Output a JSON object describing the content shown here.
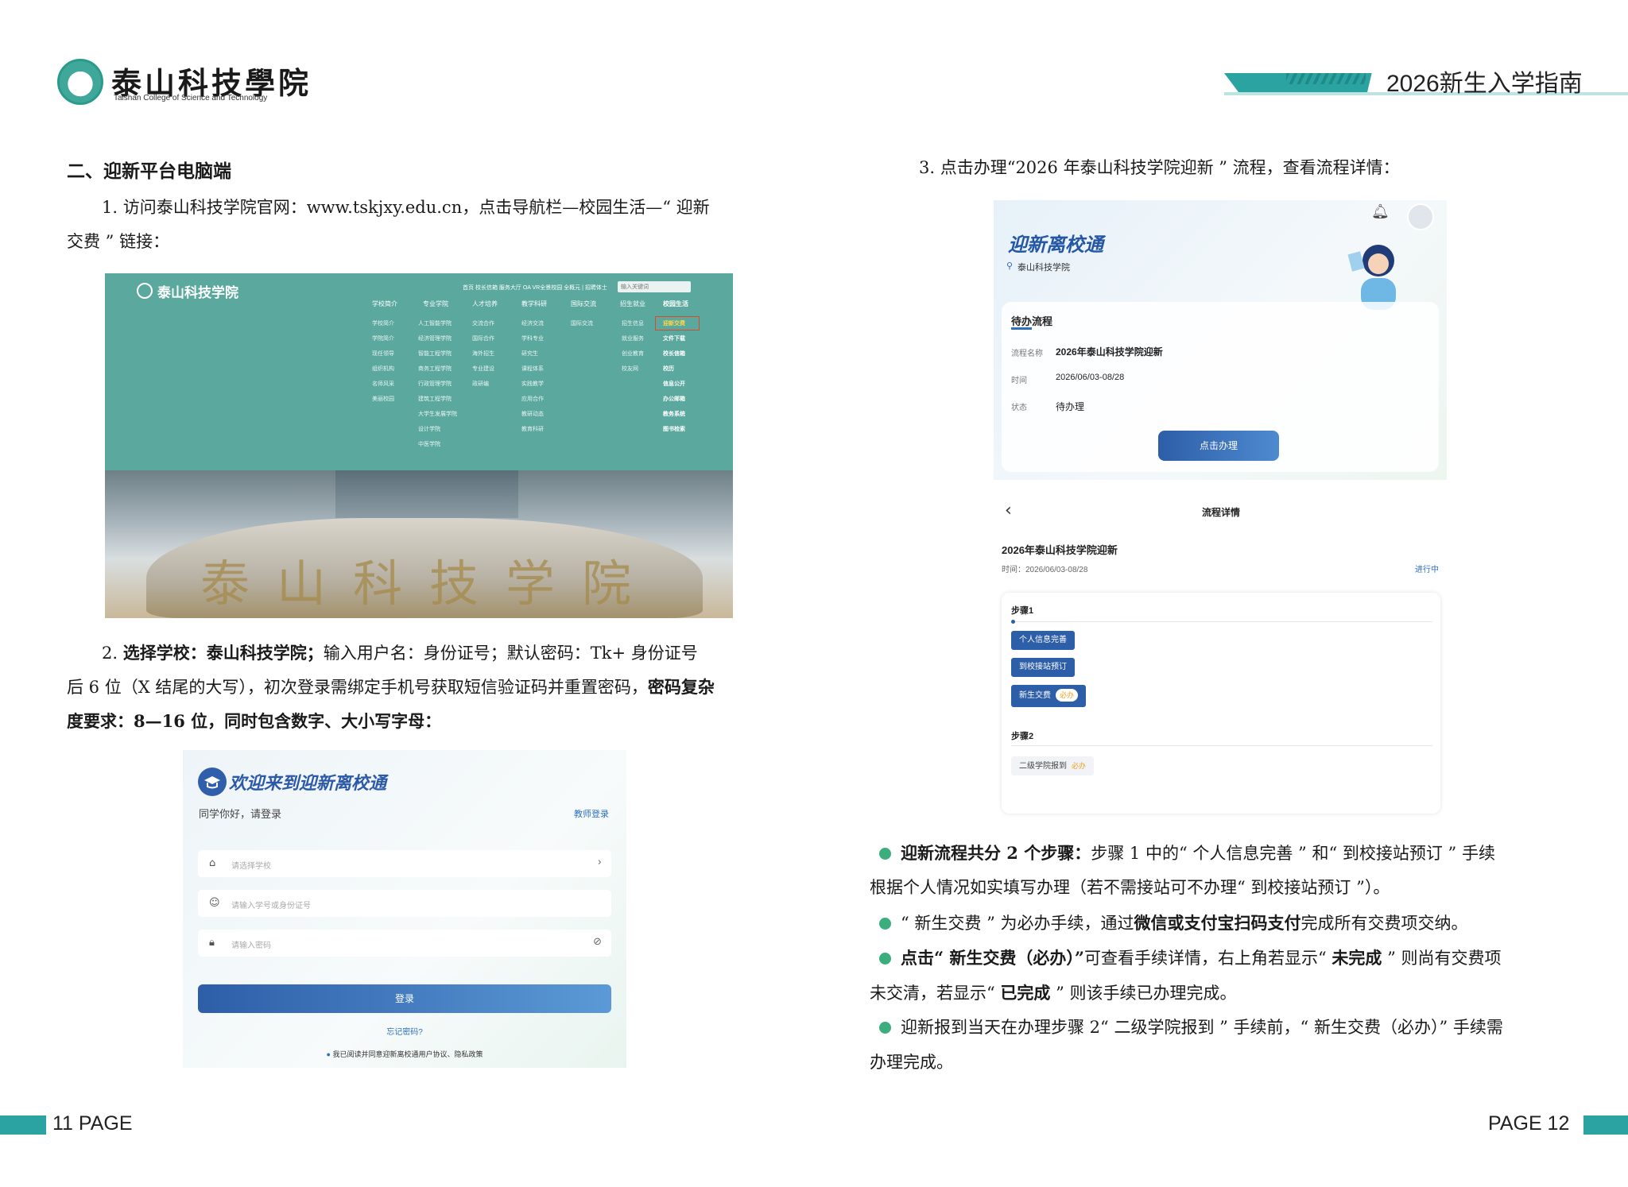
{
  "header": {
    "logo_cn": "泰山科技學院",
    "logo_en": "Taishan College of Science and Technology",
    "guide_title": "2026新生入学指南"
  },
  "left": {
    "section_title": "二、迎新平台电脑端",
    "step1_line1": "1. 访问泰山科技学院官网：www.tskjxy.edu.cn，点击导航栏—校园生活—“ 迎新",
    "step1_line2": "交费 ” 链接：",
    "step2_l1_a": "2. ",
    "step2_l1_b": "选择学校：泰山科技学院；",
    "step2_l1_c": "输入用户名：身份证号；默认密码：Tk+ 身份证号",
    "step2_l2_a": "后 6 位（X 结尾的大写），初次登录需绑定手机号获取短信验证码并重置密码，",
    "step2_l2_b": "密码复杂",
    "step2_l3_a": "度要求：",
    "step2_l3_b": "8—16 位，同时包含数字、大小写字母："
  },
  "website": {
    "logo": "泰山科技学院",
    "toplinks": "首页  校长信箱  服务大厅  OA  VR全景校园  全概元  |  招聘体士",
    "search_placeholder": "输入关键词",
    "nav": [
      "学校简介",
      "专业学院",
      "人才培养",
      "教学科研",
      "国际交流",
      "招生就业",
      "校园生活"
    ],
    "col1": [
      "学校简介",
      "学院简介",
      "现任领导",
      "组织机构",
      "名师风采",
      "美丽校园"
    ],
    "col2": [
      "人工智能学院",
      "经济管理学院",
      "智能工程学院",
      "商务工程学院",
      "行政管理学院",
      "建筑工程学院",
      "大学生发展学院",
      "设计学院",
      "中医学院"
    ],
    "col3": [
      "交流合作",
      "国际合作",
      "海外招生",
      "专业建设",
      "政研编"
    ],
    "col4": [
      "经济交流",
      "学科专业",
      "研究生",
      "课程体系",
      "实践教学",
      "应用合作",
      "教研动态",
      "教育科研"
    ],
    "col5": [
      "国际交流"
    ],
    "col6": [
      "招生信息",
      "就业服务",
      "创业教育",
      "校友网"
    ],
    "col7": [
      "迎新交费",
      "文件下载",
      "校长信箱",
      "校历",
      "信息公开",
      "办公邮箱",
      "教务系统",
      "图书检索"
    ],
    "stone_text": "泰山科技学院"
  },
  "login": {
    "title": "欢迎来到迎新离校通",
    "hello": "同学你好，请登录",
    "teacher_link": "教师登录",
    "school_placeholder": "请选择学校",
    "user_placeholder": "请输入学号或身份证号",
    "password_placeholder": "请输入密码",
    "login_button": "登录",
    "forgot": "忘记密码?",
    "agree": "我已阅读并同意迎新离校通用户协议、隐私政策"
  },
  "right": {
    "step3": "3. 点击办理“2026 年泰山科技学院迎新 ” 流程，查看流程详情："
  },
  "app": {
    "title": "迎新离校通",
    "school": "泰山科技学院",
    "pending_title": "待办流程",
    "k_name": "流程名称",
    "v_name": "2026年泰山科技学院迎新",
    "k_time": "时间",
    "v_time": "2026/06/03-08/28",
    "k_status": "状态",
    "v_status": "待办理",
    "button": "点击办理"
  },
  "detail": {
    "title": "流程详情",
    "name": "2026年泰山科技学院迎新",
    "time": "时间：2026/06/03-08/28",
    "status": "进行中",
    "step1": "步骤1",
    "tag1": "个人信息完善",
    "tag2": "到校接站预订",
    "tag3": "新生交费",
    "required": "必办",
    "step2": "步骤2",
    "tag4": "二级学院报到"
  },
  "notes": {
    "n1_a": "迎新流程共分 2 个步骤：",
    "n1_b": "步骤 1 中的“ 个人信息完善 ” 和“ 到校接站预订 ” 手续",
    "n1_c": "根据个人情况如实填写办理（若不需接站可不办理“ 到校接站预订 ”）。",
    "n2_a": "“ 新生交费 ” 为必办手续，通过",
    "n2_b": "微信或支付宝扫码支付",
    "n2_c": "完成所有交费项交纳。",
    "n3_a": "点击“ 新生交费（必办）”",
    "n3_b": "可查看手续详情，右上角若显示“ ",
    "n3_c": "未完成",
    "n3_d": " ” 则尚有交费项",
    "n3_e": "未交清，若显示“ ",
    "n3_f": "已完成",
    "n3_g": " ” 则该手续已办理完成。",
    "n4_a": "迎新报到当天在办理步骤 2“ 二级学院报到 ” 手续前，“ 新生交费（必办）” 手续需",
    "n4_b": "办理完成。"
  },
  "footer": {
    "left": "11 PAGE",
    "right": "PAGE 12"
  },
  "colors": {
    "teal": "#2ba3a0",
    "blue": "#2d5ea8",
    "green_bullet": "#3cad7c"
  }
}
